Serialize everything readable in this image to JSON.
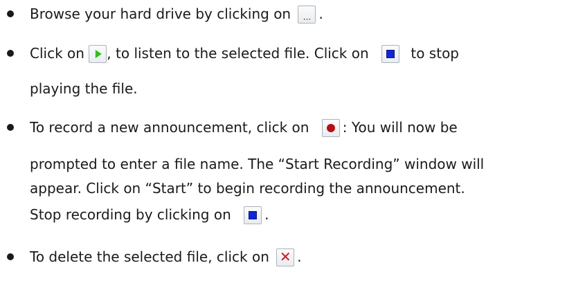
{
  "items": [
    {
      "lines": [
        {
          "segments": [
            "Browse your hard drive by clicking on ",
            "."
          ]
        }
      ]
    },
    {
      "lines": [
        {
          "segments": [
            "Click on ",
            ", to listen to the selected file. Click on ",
            " to stop"
          ]
        },
        {
          "segments": [
            "playing the file."
          ]
        }
      ]
    },
    {
      "lines": [
        {
          "segments": [
            "To record a new announcement, click on ",
            ": You will now be"
          ]
        },
        {
          "segments": [
            "prompted to enter a file name. The “Start Recording” window will"
          ]
        },
        {
          "segments": [
            "appear. Click on “Start” to begin recording the announcement."
          ]
        },
        {
          "segments": [
            "Stop recording by clicking on ",
            "."
          ]
        }
      ]
    },
    {
      "lines": [
        {
          "segments": [
            "To delete the selected file, click on ",
            "."
          ]
        }
      ]
    }
  ],
  "icons": {
    "browse": "ellipsis-icon",
    "play": "play-icon",
    "stop": "stop-icon",
    "record": "record-icon",
    "delete": "delete-icon"
  },
  "icon_glyphs": {
    "browse": "...",
    "delete": "✕"
  },
  "colors": {
    "text": "#1a1a1a",
    "play": "#2fbf1a",
    "stop": "#1126d8",
    "record": "#b40f14",
    "delete": "#d2141a",
    "button_border": "#a9b3bd"
  }
}
